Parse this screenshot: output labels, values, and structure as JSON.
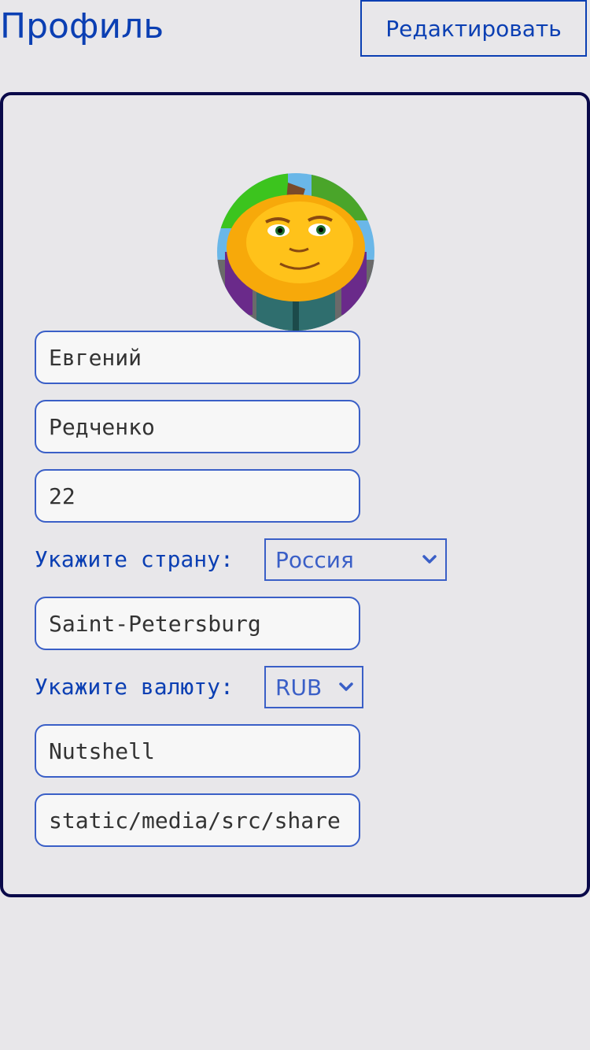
{
  "header": {
    "title": "Профиль",
    "edit_label": "Редактировать"
  },
  "profile": {
    "first_name": "Евгений",
    "last_name": "Редченко",
    "age": "22",
    "country_label": "Укажите страну:",
    "country_value": "Россия",
    "city": "Saint-Petersburg",
    "currency_label": "Укажите валюту:",
    "currency_value": "RUB",
    "username": "Nutshell",
    "avatar_path": "static/media/src/share"
  },
  "icons": {
    "avatar": "pumpkin-character-avatar",
    "chevron": "chevron-down-icon"
  },
  "colors": {
    "accent": "#0b3fb3",
    "border": "#3a5fc7",
    "card_border": "#0a0a4a",
    "background": "#e8e7ea"
  }
}
